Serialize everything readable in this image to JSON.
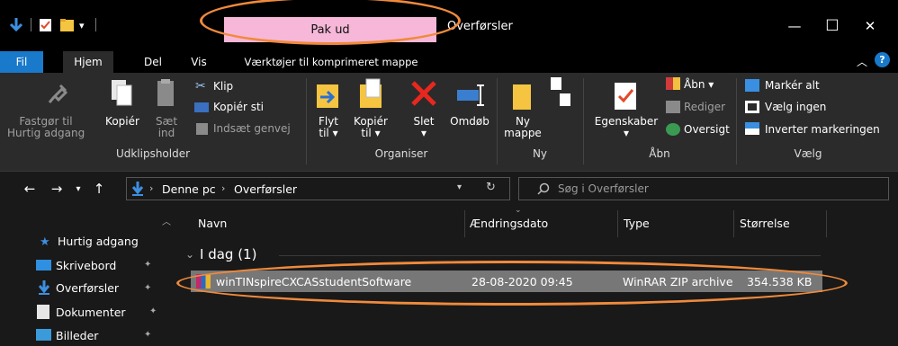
{
  "titlebar": {
    "context_tab": "Pak ud",
    "window_title": "Overførsler",
    "minimize": "—",
    "maximize": "☐",
    "close": "✕"
  },
  "tabs": {
    "fil": "Fil",
    "hjem": "Hjem",
    "del": "Del",
    "vis": "Vis",
    "context": "Værktøjer til komprimeret mappe"
  },
  "ribbon": {
    "udklip": {
      "pin_line1": "Fastgør til",
      "pin_line2": "Hurtig adgang",
      "copy": "Kopiér",
      "paste_line1": "Sæt",
      "paste_line2": "ind",
      "cut": "Klip",
      "copy_path": "Kopiér sti",
      "paste_shortcut": "Indsæt genvej",
      "label": "Udklipsholder"
    },
    "organiser": {
      "move_line1": "Flyt",
      "move_line2": "til ▾",
      "copyto_line1": "Kopiér",
      "copyto_line2": "til ▾",
      "delete_line1": "Slet",
      "delete_line2": "▾",
      "rename": "Omdøb",
      "label": "Organiser"
    },
    "ny": {
      "new_line1": "Ny",
      "new_line2": "mappe",
      "label": "Ny"
    },
    "aabn": {
      "props_line1": "Egenskaber",
      "props_line2": "▾",
      "open": "Åbn ▾",
      "edit": "Rediger",
      "history": "Oversigt",
      "label": "Åbn"
    },
    "vaelg": {
      "select_all": "Markér alt",
      "select_none": "Vælg ingen",
      "invert": "Inverter markeringen",
      "label": "Vælg"
    }
  },
  "address": {
    "root": "Denne pc",
    "current": "Overførsler",
    "search_placeholder": "Søg i Overførsler"
  },
  "nav_pane": {
    "items": [
      {
        "label": "Hurtig adgang"
      },
      {
        "label": "Skrivebord"
      },
      {
        "label": "Overførsler"
      },
      {
        "label": "Dokumenter"
      },
      {
        "label": "Billeder"
      }
    ]
  },
  "list": {
    "columns": [
      "Navn",
      "Ændringsdato",
      "Type",
      "Størrelse"
    ],
    "group": "I dag (1)",
    "files": [
      {
        "name": "winTINspireCXCASstudentSoftware",
        "date": "28-08-2020 09:45",
        "type": "WinRAR ZIP archive",
        "size": "354.538 KB"
      }
    ]
  },
  "colors": {
    "accent": "#1979ca",
    "context_tab": "#f7b7d8",
    "annotation": "#f08a3c",
    "selection": "#777777"
  }
}
